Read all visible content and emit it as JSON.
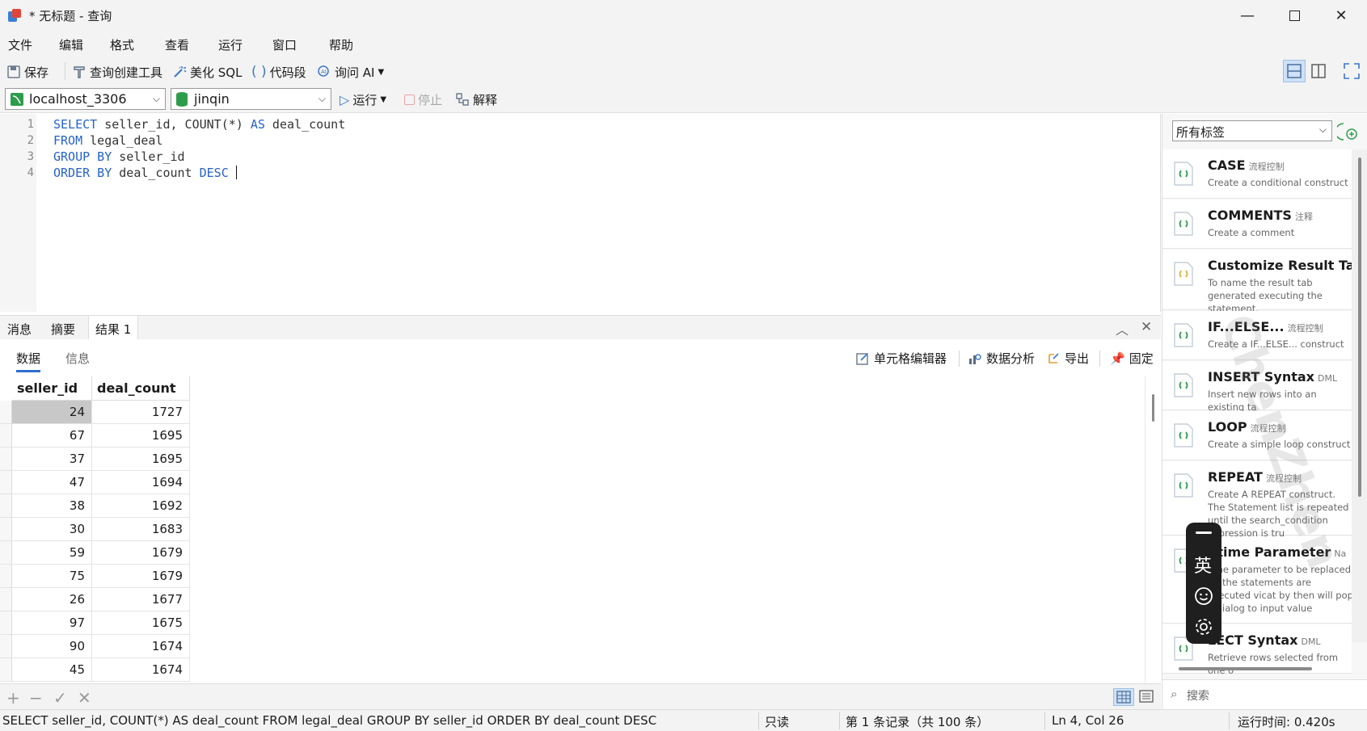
{
  "window": {
    "title": "* 无标题 - 查询"
  },
  "menu": [
    "文件",
    "编辑",
    "格式",
    "查看",
    "运行",
    "窗口",
    "帮助"
  ],
  "toolbar": {
    "save": "保存",
    "query_builder": "查询创建工具",
    "beautify": "美化 SQL",
    "snippet": "代码段",
    "ask_ai": "询问 AI"
  },
  "connection": {
    "server": "localhost_3306",
    "database": "jinqin",
    "run": "运行",
    "stop": "停止",
    "explain": "解释"
  },
  "editor": {
    "line_numbers": [
      "1",
      "2",
      "3",
      "4"
    ],
    "lines": [
      {
        "kw1": "SELECT",
        "t1": " seller_id, COUNT(*) ",
        "kw2": "AS",
        "t2": " deal_count"
      },
      {
        "kw1": "FROM",
        "t1": " legal_deal",
        "kw2": "",
        "t2": ""
      },
      {
        "kw1": "GROUP BY",
        "t1": " seller_id",
        "kw2": "",
        "t2": ""
      },
      {
        "kw1": "ORDER BY",
        "t1": " deal_count ",
        "kw2": "DESC",
        "t2": " "
      }
    ]
  },
  "results": {
    "tabs": [
      "消息",
      "摘要",
      "结果 1"
    ],
    "subtabs": [
      "数据",
      "信息"
    ],
    "actions": {
      "cell_editor": "单元格编辑器",
      "analyze": "数据分析",
      "export": "导出",
      "pin": "固定"
    },
    "columns": [
      "seller_id",
      "deal_count"
    ],
    "rows": [
      [
        "24",
        "1727"
      ],
      [
        "67",
        "1695"
      ],
      [
        "37",
        "1695"
      ],
      [
        "47",
        "1694"
      ],
      [
        "38",
        "1692"
      ],
      [
        "30",
        "1683"
      ],
      [
        "59",
        "1679"
      ],
      [
        "75",
        "1679"
      ],
      [
        "26",
        "1677"
      ],
      [
        "97",
        "1675"
      ],
      [
        "90",
        "1674"
      ],
      [
        "45",
        "1674"
      ]
    ]
  },
  "grid_footer": {
    "add": "+",
    "remove": "−",
    "apply": "✓",
    "discard": "✕"
  },
  "status": {
    "sql": "SELECT seller_id, COUNT(*) AS deal_count FROM legal_deal GROUP BY seller_id ORDER BY deal_count DESC",
    "readonly": "只读",
    "record": "第 1 条记录（共 100 条）",
    "position": "Ln 4, Col 26",
    "runtime": "运行时间: 0.420s"
  },
  "snippets": {
    "filter": "所有标签",
    "search_placeholder": "搜索",
    "items": [
      {
        "title": "CASE",
        "tag": "流程控制",
        "desc": "Create a conditional construct"
      },
      {
        "title": "COMMENTS",
        "tag": "注释",
        "desc": "Create a comment"
      },
      {
        "title": "Customize Result Tab",
        "tag": "",
        "desc": "To name the result tab generated executing the statement."
      },
      {
        "title": "IF...ELSE...",
        "tag": "流程控制",
        "desc": "Create a IF...ELSE... construct"
      },
      {
        "title": "INSERT Syntax",
        "tag": "DML",
        "desc": "Insert new rows into an existing ta"
      },
      {
        "title": "LOOP",
        "tag": "流程控制",
        "desc": "Create a simple loop construct"
      },
      {
        "title": "REPEAT",
        "tag": "流程控制",
        "desc": "Create A REPEAT construct. The Statement list is repeated until the search_condition expression is tru"
      },
      {
        "title": "ntime Parameter",
        "tag": "Na",
        "desc": "time parameter to be replaced en the statements are executed vicat by then will pop a dialog to input value"
      },
      {
        "title": "LECT Syntax",
        "tag": "DML",
        "desc": "Retrieve rows selected from one o"
      }
    ]
  },
  "ime": {
    "lang": "英"
  },
  "colors": {
    "keyword": "#2563c9",
    "accent": "#2b6fd1",
    "selected_cell": "#c8c8c8"
  }
}
